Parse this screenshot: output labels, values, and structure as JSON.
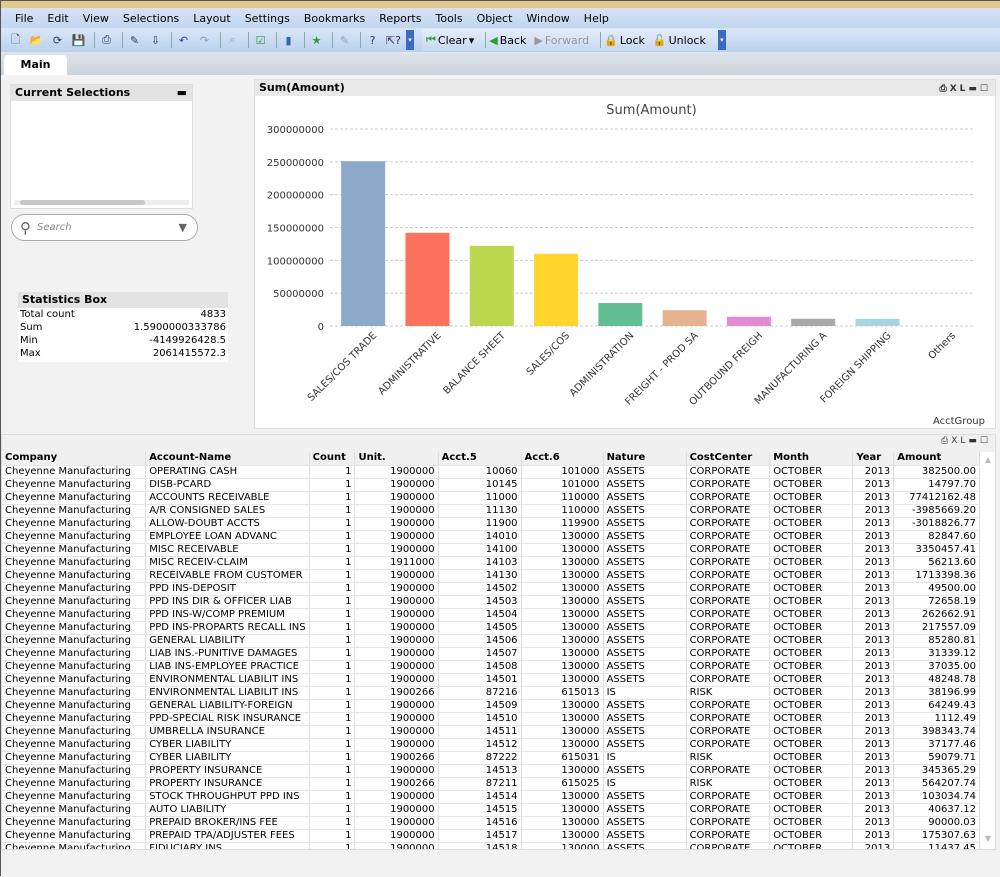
{
  "menu": [
    "File",
    "Edit",
    "View",
    "Selections",
    "Layout",
    "Settings",
    "Bookmarks",
    "Reports",
    "Tools",
    "Object",
    "Window",
    "Help"
  ],
  "toolbar": {
    "clear": "Clear",
    "back": "Back",
    "forward": "Forward",
    "lock": "Lock",
    "unlock": "Unlock"
  },
  "tabs": [
    "Main"
  ],
  "current_selections": {
    "title": "Current Selections"
  },
  "search": {
    "placeholder": "Search"
  },
  "stats": {
    "title": "Statistics Box",
    "rows": [
      {
        "label": "Total count",
        "value": "4833"
      },
      {
        "label": "Sum",
        "value": "1.5900000333786"
      },
      {
        "label": "Min",
        "value": "-4149926428.5"
      },
      {
        "label": "Max",
        "value": "2061415572.3"
      }
    ]
  },
  "chart_box": {
    "caption": "Sum(Amount)",
    "xl": "XL"
  },
  "chart_data": {
    "type": "bar",
    "title": "Sum(Amount)",
    "xlabel": "AcctGroup",
    "ylabel": "",
    "ylim": [
      0,
      300000000
    ],
    "grid": true,
    "yticks": [
      "0",
      "50000000",
      "100000000",
      "150000000",
      "200000000",
      "250000000",
      "300000000"
    ],
    "categories": [
      "SALES/COS TRADE",
      "ADMINISTRATIVE",
      "BALANCE SHEET",
      "SALES/COS",
      "ADMINISTRATION",
      "FREIGHT - PROD SA",
      "OUTBOUND FREIGH",
      "MANUFACTURING A",
      "FOREIGN SHIPPING",
      "Others"
    ],
    "values": [
      251000000,
      142000000,
      122000000,
      110000000,
      35000000,
      24000000,
      14000000,
      11000000,
      11000000,
      0
    ],
    "colors": [
      "#8eaacb",
      "#fc735d",
      "#bcd74e",
      "#fed62e",
      "#63bf93",
      "#e5b48f",
      "#e38ad4",
      "#a9a9a9",
      "#a7d6e1",
      "#ffffff"
    ]
  },
  "table": {
    "xl": "XL",
    "columns": [
      "Company",
      "Account-Name",
      "Count",
      "Unit.",
      "Acct.5",
      "Acct.6",
      "Nature",
      "CostCenter",
      "Month",
      "Year",
      "Amount"
    ],
    "rows": [
      [
        "Cheyenne Manufacturing",
        "OPERATING CASH",
        "1",
        "1900000",
        "10060",
        "101000",
        "ASSETS",
        "CORPORATE",
        "OCTOBER",
        "2013",
        "382500.00"
      ],
      [
        "Cheyenne Manufacturing",
        "DISB-PCARD",
        "1",
        "1900000",
        "10145",
        "101000",
        "ASSETS",
        "CORPORATE",
        "OCTOBER",
        "2013",
        "14797.70"
      ],
      [
        "Cheyenne Manufacturing",
        "ACCOUNTS RECEIVABLE",
        "1",
        "1900000",
        "11000",
        "110000",
        "ASSETS",
        "CORPORATE",
        "OCTOBER",
        "2013",
        "77412162.48"
      ],
      [
        "Cheyenne Manufacturing",
        "A/R CONSIGNED SALES",
        "1",
        "1900000",
        "11130",
        "110000",
        "ASSETS",
        "CORPORATE",
        "OCTOBER",
        "2013",
        "-3985669.20"
      ],
      [
        "Cheyenne Manufacturing",
        "ALLOW-DOUBT ACCTS",
        "1",
        "1900000",
        "11900",
        "119900",
        "ASSETS",
        "CORPORATE",
        "OCTOBER",
        "2013",
        "-3018826.77"
      ],
      [
        "Cheyenne Manufacturing",
        "EMPLOYEE LOAN ADVANC",
        "1",
        "1900000",
        "14010",
        "130000",
        "ASSETS",
        "CORPORATE",
        "OCTOBER",
        "2013",
        "82847.60"
      ],
      [
        "Cheyenne Manufacturing",
        "MISC RECEIVABLE",
        "1",
        "1900000",
        "14100",
        "130000",
        "ASSETS",
        "CORPORATE",
        "OCTOBER",
        "2013",
        "3350457.41"
      ],
      [
        "Cheyenne Manufacturing",
        "MISC RECEIV-CLAIM",
        "1",
        "1911000",
        "14103",
        "130000",
        "ASSETS",
        "CORPORATE",
        "OCTOBER",
        "2013",
        "56213.60"
      ],
      [
        "Cheyenne Manufacturing",
        "RECEIVABLE FROM CUSTOMER",
        "1",
        "1900000",
        "14130",
        "130000",
        "ASSETS",
        "CORPORATE",
        "OCTOBER",
        "2013",
        "1713398.36"
      ],
      [
        "Cheyenne Manufacturing",
        "PPD INS-DEPOSIT",
        "1",
        "1900000",
        "14502",
        "130000",
        "ASSETS",
        "CORPORATE",
        "OCTOBER",
        "2013",
        "49500.00"
      ],
      [
        "Cheyenne Manufacturing",
        "PPD INS DIR & OFFICER LIAB",
        "1",
        "1900000",
        "14503",
        "130000",
        "ASSETS",
        "CORPORATE",
        "OCTOBER",
        "2013",
        "72658.19"
      ],
      [
        "Cheyenne Manufacturing",
        "PPD INS-W/COMP PREMIUM",
        "1",
        "1900000",
        "14504",
        "130000",
        "ASSETS",
        "CORPORATE",
        "OCTOBER",
        "2013",
        "262662.91"
      ],
      [
        "Cheyenne Manufacturing",
        "PPD INS-PROPARTS RECALL INS",
        "1",
        "1900000",
        "14505",
        "130000",
        "ASSETS",
        "CORPORATE",
        "OCTOBER",
        "2013",
        "217557.09"
      ],
      [
        "Cheyenne Manufacturing",
        "GENERAL LIABILITY",
        "1",
        "1900000",
        "14506",
        "130000",
        "ASSETS",
        "CORPORATE",
        "OCTOBER",
        "2013",
        "85280.81"
      ],
      [
        "Cheyenne Manufacturing",
        "LIAB INS.-PUNITIVE DAMAGES",
        "1",
        "1900000",
        "14507",
        "130000",
        "ASSETS",
        "CORPORATE",
        "OCTOBER",
        "2013",
        "31339.12"
      ],
      [
        "Cheyenne Manufacturing",
        "LIAB INS-EMPLOYEE PRACTICE",
        "1",
        "1900000",
        "14508",
        "130000",
        "ASSETS",
        "CORPORATE",
        "OCTOBER",
        "2013",
        "37035.00"
      ],
      [
        "Cheyenne Manufacturing",
        "ENVIRONMENTAL LIABILIT INS",
        "1",
        "1900000",
        "14501",
        "130000",
        "ASSETS",
        "CORPORATE",
        "OCTOBER",
        "2013",
        "48248.78"
      ],
      [
        "Cheyenne Manufacturing",
        "ENVIRONMENTAL LIABILIT INS",
        "1",
        "1900266",
        "87216",
        "615013",
        "IS",
        "RISK",
        "OCTOBER",
        "2013",
        "38196.99"
      ],
      [
        "Cheyenne Manufacturing",
        "GENERAL LIABILITY-FOREIGN",
        "1",
        "1900000",
        "14509",
        "130000",
        "ASSETS",
        "CORPORATE",
        "OCTOBER",
        "2013",
        "64249.43"
      ],
      [
        "Cheyenne Manufacturing",
        "PPD-SPECIAL RISK INSURANCE",
        "1",
        "1900000",
        "14510",
        "130000",
        "ASSETS",
        "CORPORATE",
        "OCTOBER",
        "2013",
        "1112.49"
      ],
      [
        "Cheyenne Manufacturing",
        "UMBRELLA INSURANCE",
        "1",
        "1900000",
        "14511",
        "130000",
        "ASSETS",
        "CORPORATE",
        "OCTOBER",
        "2013",
        "398343.74"
      ],
      [
        "Cheyenne Manufacturing",
        "CYBER LIABILITY",
        "1",
        "1900000",
        "14512",
        "130000",
        "ASSETS",
        "CORPORATE",
        "OCTOBER",
        "2013",
        "37177.46"
      ],
      [
        "Cheyenne Manufacturing",
        "CYBER LIABILITY",
        "1",
        "1900266",
        "87222",
        "615031",
        "IS",
        "RISK",
        "OCTOBER",
        "2013",
        "59079.71"
      ],
      [
        "Cheyenne Manufacturing",
        "PROPERTY INSURANCE",
        "1",
        "1900000",
        "14513",
        "130000",
        "ASSETS",
        "CORPORATE",
        "OCTOBER",
        "2013",
        "345365.29"
      ],
      [
        "Cheyenne Manufacturing",
        "PROPERTY INSURANCE",
        "1",
        "1900266",
        "87211",
        "615025",
        "IS",
        "RISK",
        "OCTOBER",
        "2013",
        "564207.74"
      ],
      [
        "Cheyenne Manufacturing",
        "STOCK THROUGHPUT PPD INS",
        "1",
        "1900000",
        "14514",
        "130000",
        "ASSETS",
        "CORPORATE",
        "OCTOBER",
        "2013",
        "103034.74"
      ],
      [
        "Cheyenne Manufacturing",
        "AUTO LIABILITY",
        "1",
        "1900000",
        "14515",
        "130000",
        "ASSETS",
        "CORPORATE",
        "OCTOBER",
        "2013",
        "40637.12"
      ],
      [
        "Cheyenne Manufacturing",
        "PREPAID BROKER/INS FEE",
        "1",
        "1900000",
        "14516",
        "130000",
        "ASSETS",
        "CORPORATE",
        "OCTOBER",
        "2013",
        "90000.03"
      ],
      [
        "Cheyenne Manufacturing",
        "PREPAID TPA/ADJUSTER FEES",
        "1",
        "1900000",
        "14517",
        "130000",
        "ASSETS",
        "CORPORATE",
        "OCTOBER",
        "2013",
        "175307.63"
      ],
      [
        "Cheyenne Manufacturing",
        "FIDUCIARY INS",
        "1",
        "1900000",
        "14518",
        "130000",
        "ASSETS",
        "CORPORATE",
        "OCTOBER",
        "2013",
        "11437.45"
      ]
    ]
  }
}
